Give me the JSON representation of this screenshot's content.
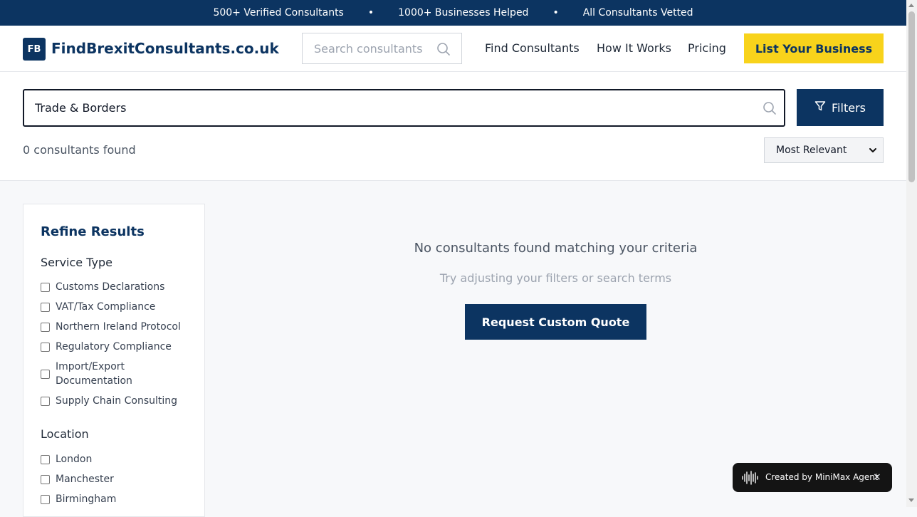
{
  "banner": {
    "stat1": "500+ Verified Consultants",
    "sep": "•",
    "stat2": "1000+ Businesses Helped",
    "stat3": "All Consultants Vetted"
  },
  "header": {
    "logo_initials": "FB",
    "logo_text": "FindBrexitConsultants.co.uk",
    "search_placeholder": "Search consultants",
    "nav": {
      "find": "Find Consultants",
      "how": "How It Works",
      "pricing": "Pricing"
    },
    "cta": "List Your Business"
  },
  "search": {
    "query": "Trade & Borders",
    "filters_label": "Filters",
    "results_count_text": "0 consultants found",
    "sort_selected": "Most Relevant"
  },
  "sidebar": {
    "title": "Refine Results",
    "service_type": {
      "title": "Service Type",
      "options": [
        "Customs Declarations",
        "VAT/Tax Compliance",
        "Northern Ireland Protocol",
        "Regulatory Compliance",
        "Import/Export Documentation",
        "Supply Chain Consulting"
      ]
    },
    "location": {
      "title": "Location",
      "options": [
        "London",
        "Manchester",
        "Birmingham"
      ]
    }
  },
  "results": {
    "empty_title": "No consultants found matching your criteria",
    "empty_sub": "Try adjusting your filters or search terms",
    "quote_button": "Request Custom Quote"
  },
  "badge": {
    "text": "Created by MiniMax Agent",
    "close": "×"
  },
  "colors": {
    "brand_navy": "#0c3461",
    "accent_yellow": "#f8d31b"
  }
}
